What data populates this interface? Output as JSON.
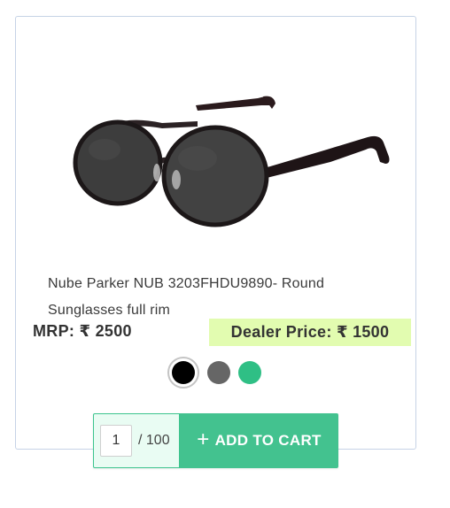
{
  "product": {
    "title_line1": "Nube Parker NUB 3203FHDU9890- Round",
    "title_line2": "Sunglasses full rim",
    "image_icon": "round-sunglasses-image"
  },
  "pricing": {
    "mrp": "MRP: ₹ 2500",
    "dealer_price": "Dealer Price: ₹ 1500",
    "dealer_highlight_color": "#e2fcb0"
  },
  "colors": {
    "options": [
      {
        "name": "black",
        "hex": "#000000",
        "selected": true
      },
      {
        "name": "grey",
        "hex": "#666666",
        "selected": false
      },
      {
        "name": "green",
        "hex": "#2fbf85",
        "selected": false
      }
    ]
  },
  "cart": {
    "quantity": "1",
    "max": "/ 100",
    "add_label": "ADD TO CART",
    "plus_icon": "+",
    "accent_color": "#43c28f"
  }
}
